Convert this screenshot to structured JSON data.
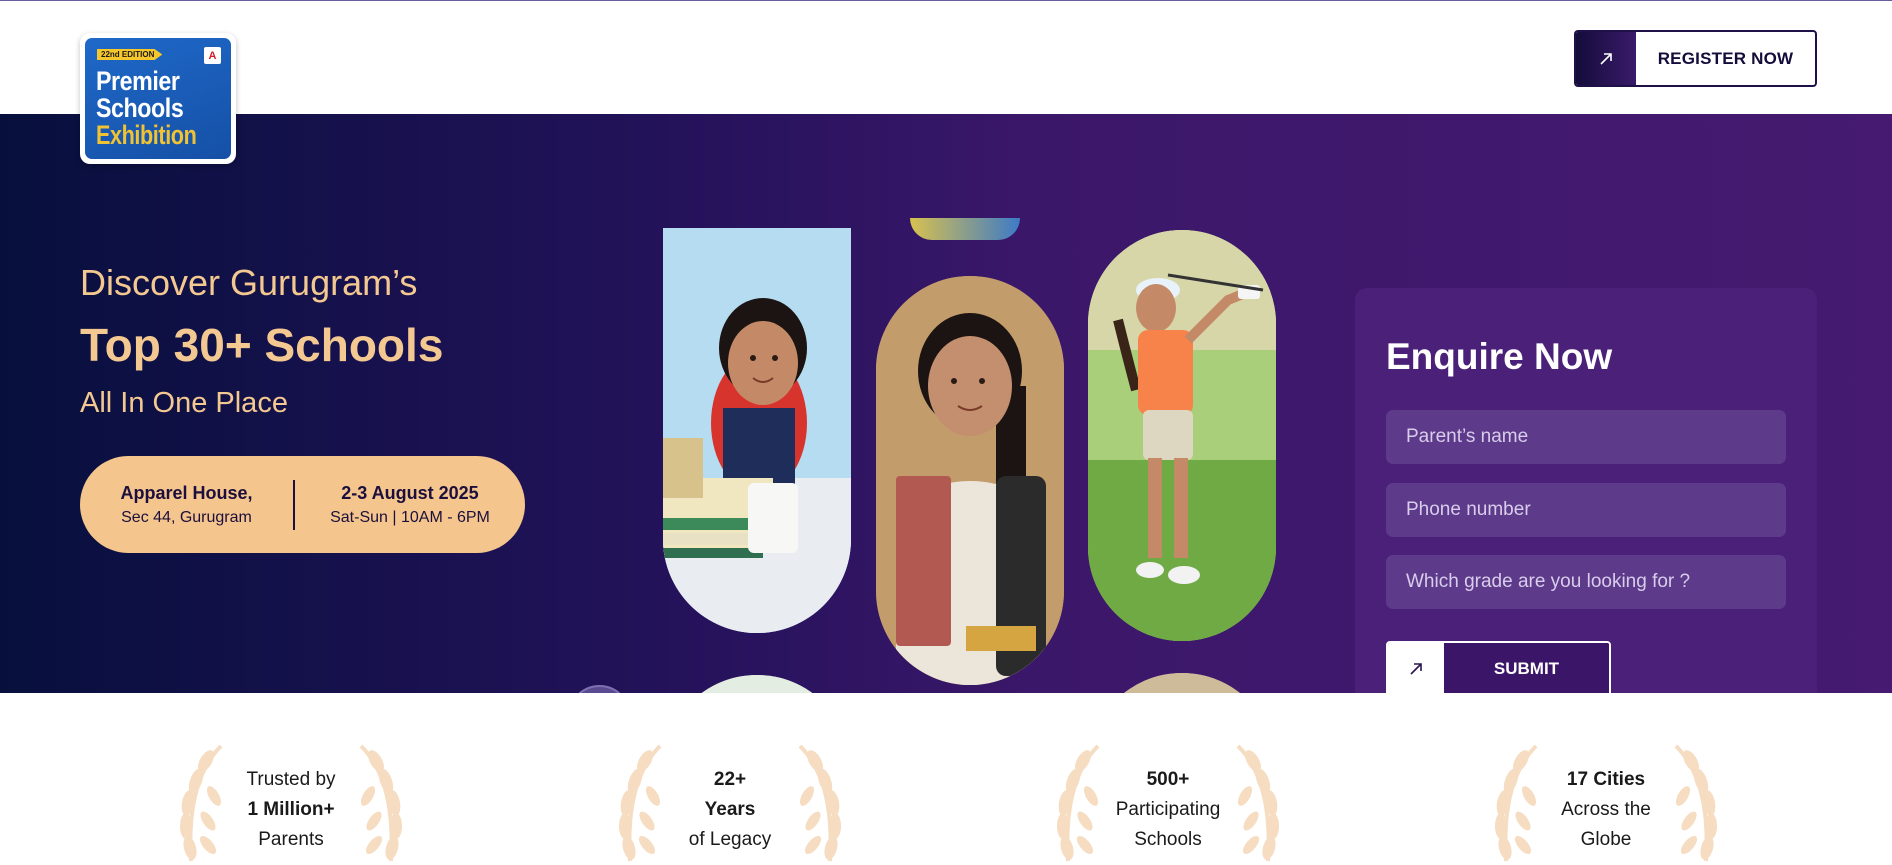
{
  "logo": {
    "edition": "22nd EDITION",
    "line1": "Premier",
    "line2": "Schools",
    "line3": "Exhibition"
  },
  "header": {
    "register_label": "REGISTER NOW"
  },
  "hero": {
    "line1": "Discover Gurugram’s",
    "line2": "Top 30+ Schools",
    "line3": "All In One Place",
    "venue_title": "Apparel House,",
    "venue_sub": "Sec 44, Gurugram",
    "date_title": "2-3 August 2025",
    "date_sub": "Sat-Sun | 10AM - 6PM"
  },
  "form": {
    "title": "Enquire Now",
    "name_placeholder": "Parent’s name",
    "phone_placeholder": "Phone number",
    "grade_placeholder": "Which grade are you looking for ?",
    "submit_label": "SUBMIT"
  },
  "stats": [
    {
      "pre": "Trusted by",
      "bold": "1 Million+",
      "post": "Parents"
    },
    {
      "pre": "22+",
      "bold": "Years",
      "post": "of Legacy"
    },
    {
      "pre": "500+",
      "bold": "Participating",
      "post": "Schools"
    },
    {
      "pre": "17 Cities",
      "bold": "Across the",
      "post": "Globe"
    }
  ],
  "colors": {
    "accent": "#f4c891",
    "hero_dark": "#07103d",
    "hero_purple": "#451a70",
    "form_bg": "#4a2078"
  }
}
